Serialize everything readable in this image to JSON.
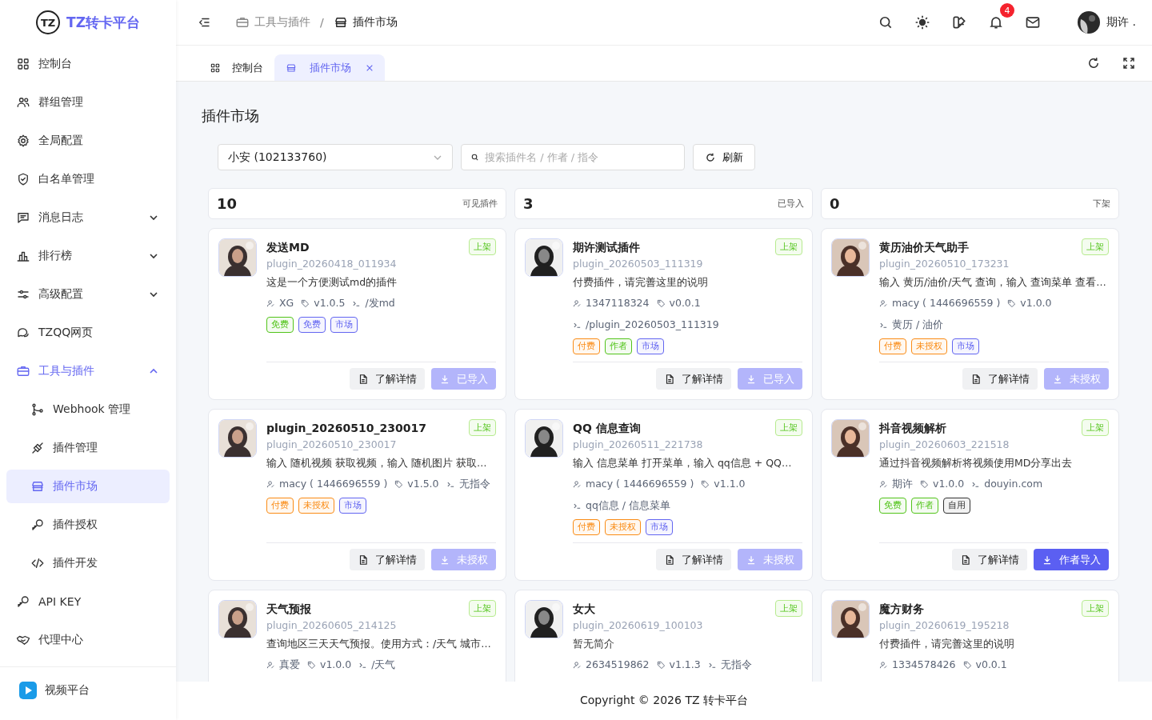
{
  "brand": {
    "logo_mark": "TZ",
    "name": "TZ转卡平台"
  },
  "sidebar": {
    "items": [
      {
        "kind": "link",
        "label": "控制台",
        "selected": false
      },
      {
        "kind": "link",
        "label": "群组管理",
        "selected": false
      },
      {
        "kind": "link",
        "label": "全局配置",
        "selected": false
      },
      {
        "kind": "link",
        "label": "白名单管理",
        "selected": false
      },
      {
        "kind": "group",
        "label": "消息日志",
        "expanded": false,
        "selected": false
      },
      {
        "kind": "group",
        "label": "排行榜",
        "expanded": false,
        "selected": false
      },
      {
        "kind": "group",
        "label": "高级配置",
        "expanded": false,
        "selected": false
      },
      {
        "kind": "link",
        "label": "TZQQ网页",
        "selected": false
      },
      {
        "kind": "group",
        "label": "工具与插件",
        "expanded": true,
        "selected": true,
        "children": [
          {
            "label": "Webhook 管理",
            "selected": false
          },
          {
            "label": "插件管理",
            "selected": false
          },
          {
            "label": "插件市场",
            "selected": true
          },
          {
            "label": "插件授权",
            "selected": false
          },
          {
            "label": "插件开发",
            "selected": false
          }
        ]
      },
      {
        "kind": "link",
        "label": "API KEY",
        "selected": false
      },
      {
        "kind": "link",
        "label": "代理中心",
        "selected": false
      }
    ],
    "footer_item": {
      "label": "视频平台"
    }
  },
  "header": {
    "breadcrumb": [
      {
        "label": "工具与插件"
      },
      {
        "label": "插件市场"
      }
    ],
    "separator": "/",
    "notification_count": "4",
    "user_name": "期许 ."
  },
  "tabs": [
    {
      "label": "控制台",
      "selected": false,
      "closable": false
    },
    {
      "label": "插件市场",
      "selected": true,
      "closable": true
    }
  ],
  "page": {
    "title": "插件市场",
    "bot_select": {
      "value": "小安 (102133760)"
    },
    "search": {
      "placeholder": "搜索插件名 / 作者 / 指令"
    },
    "refresh_button": "刷新",
    "stats": [
      {
        "count": "10",
        "caption": "可见插件"
      },
      {
        "count": "3",
        "caption": "已导入"
      },
      {
        "count": "0",
        "caption": "下架"
      }
    ],
    "plugins": [
      {
        "name": "发送MD",
        "id": "plugin_20260418_011934",
        "status": "上架",
        "description": "这是一个方便测试md的插件",
        "author": "XG",
        "version": "v1.0.5",
        "command": "/发md",
        "tags": [
          {
            "label": "免费",
            "color": "#52c41a"
          },
          {
            "label": "免费",
            "color": "#6366f1"
          },
          {
            "label": "市场",
            "color": "#6366f1"
          }
        ],
        "details_button": "了解详情",
        "action": {
          "label": "已导入",
          "disabled": true
        }
      },
      {
        "name": "期许测试插件",
        "id": "plugin_20260503_111319",
        "status": "上架",
        "description": "付费插件，请完善这里的说明",
        "author": "1347118324",
        "version": "v0.0.1",
        "command": "/plugin_20260503_111319",
        "tags": [
          {
            "label": "付费",
            "color": "#fa8c16"
          },
          {
            "label": "作者",
            "color": "#52c41a"
          },
          {
            "label": "市场",
            "color": "#6366f1"
          }
        ],
        "details_button": "了解详情",
        "action": {
          "label": "已导入",
          "disabled": true
        }
      },
      {
        "name": "黄历油价天气助手",
        "id": "plugin_20260510_173231",
        "status": "上架",
        "description": "输入 黄历/油价/天气 查询，输入 查询菜单 查看…",
        "author": "macy ( 1446696559 )",
        "version": "v1.0.0",
        "command": "黄历 / 油价",
        "tags": [
          {
            "label": "付费",
            "color": "#fa8c16"
          },
          {
            "label": "未授权",
            "color": "#fa8c16"
          },
          {
            "label": "市场",
            "color": "#6366f1"
          }
        ],
        "details_button": "了解详情",
        "action": {
          "label": "未授权",
          "disabled": true
        }
      },
      {
        "name": "plugin_20260510_230017",
        "id": "plugin_20260510_230017",
        "status": "上架",
        "description": "输入 随机视频 获取视频，输入 随机图片 获取…",
        "author": "macy ( 1446696559 )",
        "version": "v1.5.0",
        "command": "无指令",
        "tags": [
          {
            "label": "付费",
            "color": "#fa8c16"
          },
          {
            "label": "未授权",
            "color": "#fa8c16"
          },
          {
            "label": "市场",
            "color": "#6366f1"
          }
        ],
        "details_button": "了解详情",
        "action": {
          "label": "未授权",
          "disabled": true
        }
      },
      {
        "name": "QQ 信息查询",
        "id": "plugin_20260511_221738",
        "status": "上架",
        "description": "输入 信息菜单 打开菜单，输入 qq信息 + QQ…",
        "author": "macy ( 1446696559 )",
        "version": "v1.1.0",
        "command": "qq信息 / 信息菜单",
        "tags": [
          {
            "label": "付费",
            "color": "#fa8c16"
          },
          {
            "label": "未授权",
            "color": "#fa8c16"
          },
          {
            "label": "市场",
            "color": "#6366f1"
          }
        ],
        "details_button": "了解详情",
        "action": {
          "label": "未授权",
          "disabled": true
        }
      },
      {
        "name": "抖音视频解析",
        "id": "plugin_20260603_221518",
        "status": "上架",
        "description": "通过抖音视频解析将视频使用MD分享出去",
        "author": "期许",
        "version": "v1.0.0",
        "command": "douyin.com",
        "tags": [
          {
            "label": "免费",
            "color": "#52c41a"
          },
          {
            "label": "作者",
            "color": "#52c41a"
          },
          {
            "label": "自用",
            "color": "#333333"
          }
        ],
        "details_button": "了解详情",
        "action": {
          "label": "作者导入",
          "disabled": false
        }
      },
      {
        "name": "天气预报",
        "id": "plugin_20260605_214125",
        "status": "上架",
        "description": "查询地区三天天气预报。使用方式：/天气 城市…",
        "author": "真爱",
        "version": "v1.0.0",
        "command": "/天气"
      },
      {
        "name": "女大",
        "id": "plugin_20260619_100103",
        "status": "上架",
        "description": "暂无简介",
        "author": "2634519862",
        "version": "v1.1.3",
        "command": "无指令"
      },
      {
        "name": "魔方财务",
        "id": "plugin_20260619_195218",
        "status": "上架",
        "description": "付费插件，请完善这里的说明",
        "author": "1334578426",
        "version": "v0.0.1"
      }
    ]
  },
  "footer": "Copyright © 2026 TZ 转卡平台"
}
